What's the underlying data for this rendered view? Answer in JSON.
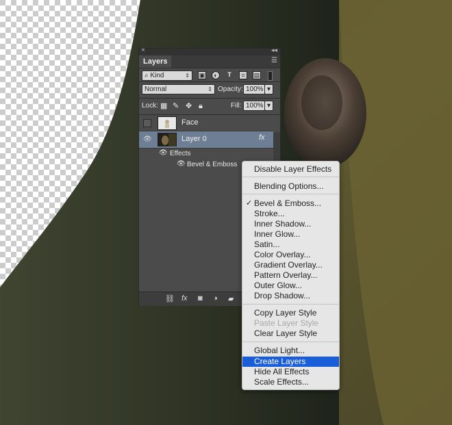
{
  "panel": {
    "tab_label": "Layers",
    "close_glyph": "×",
    "collapse_glyph": "◂◂",
    "filter_kind": "Kind",
    "blend_mode": "Normal",
    "opacity_label": "Opacity:",
    "opacity_value": "100%",
    "lock_label": "Lock:",
    "fill_label": "Fill:",
    "fill_value": "100%",
    "layers": [
      {
        "name": "Face",
        "visible": false,
        "selected": false
      },
      {
        "name": "Layer 0",
        "visible": true,
        "selected": true,
        "fx": "fx"
      }
    ],
    "effects_label": "Effects",
    "effect_item": "Bevel & Emboss"
  },
  "context_menu": {
    "items": [
      {
        "label": "Disable Layer Effects"
      },
      {
        "label": "Blending Options..."
      },
      {
        "label": "Bevel & Emboss...",
        "checked": true
      },
      {
        "label": "Stroke..."
      },
      {
        "label": "Inner Shadow..."
      },
      {
        "label": "Inner Glow..."
      },
      {
        "label": "Satin..."
      },
      {
        "label": "Color Overlay..."
      },
      {
        "label": "Gradient Overlay..."
      },
      {
        "label": "Pattern Overlay..."
      },
      {
        "label": "Outer Glow..."
      },
      {
        "label": "Drop Shadow..."
      },
      {
        "label": "Copy Layer Style"
      },
      {
        "label": "Paste Layer Style",
        "disabled": true
      },
      {
        "label": "Clear Layer Style"
      },
      {
        "label": "Global Light..."
      },
      {
        "label": "Create Layers",
        "highlighted": true
      },
      {
        "label": "Hide All Effects"
      },
      {
        "label": "Scale Effects..."
      }
    ]
  },
  "colors": {
    "menu_highlight": "#1a5dd8",
    "selected_layer": "#6e7f95",
    "panel_bg": "#4b4b4b"
  }
}
